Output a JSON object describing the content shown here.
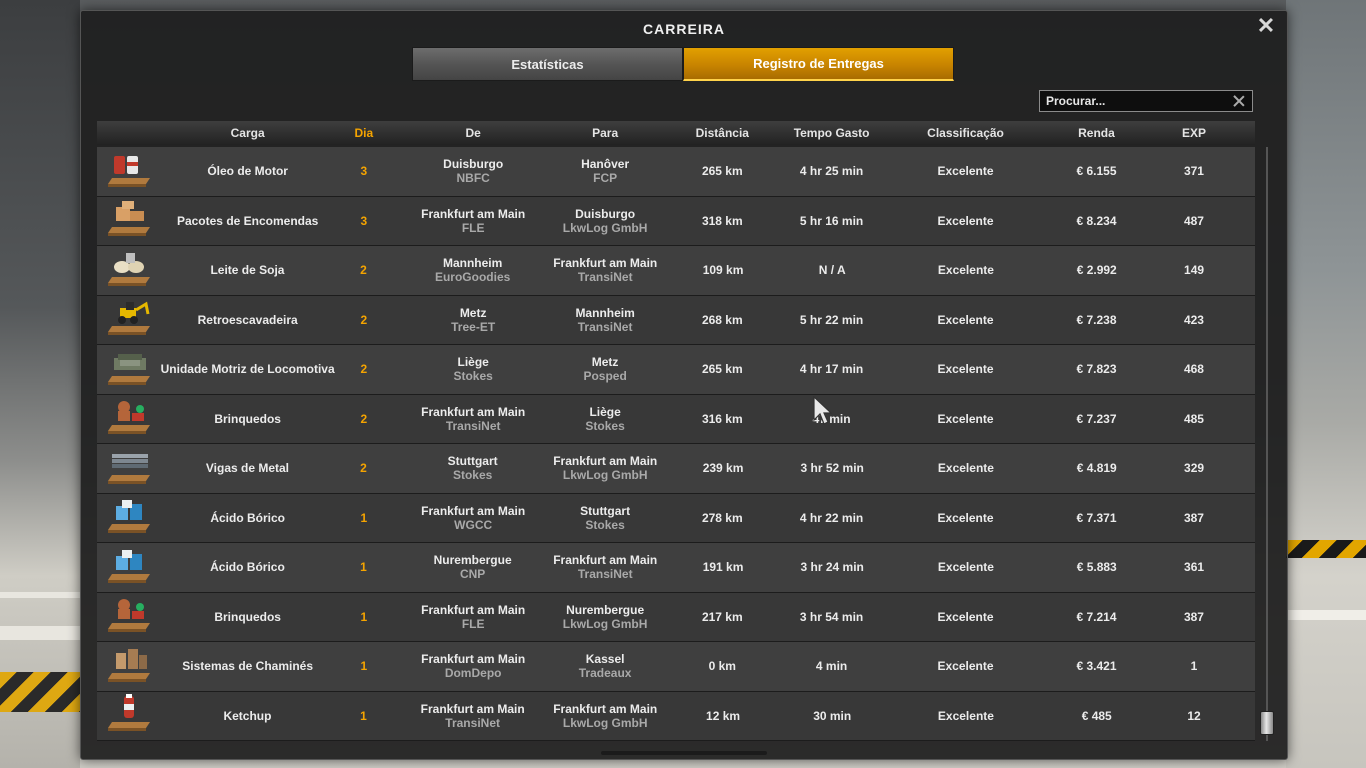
{
  "window": {
    "title": "CARREIRA"
  },
  "tabs": [
    {
      "label": "Estatísticas",
      "active": false
    },
    {
      "label": "Registro de Entregas",
      "active": true
    }
  ],
  "search": {
    "placeholder": "Procurar..."
  },
  "columns": {
    "carga": "Carga",
    "dia": "Dia",
    "de": "De",
    "para": "Para",
    "distancia": "Distância",
    "tempo": "Tempo Gasto",
    "classificacao": "Classificação",
    "renda": "Renda",
    "exp": "EXP"
  },
  "colors": {
    "accent": "#f5a400",
    "tab_active": "#d08c00"
  },
  "deliveries": [
    {
      "icon": "barrels-cargo-icon",
      "carga": "Óleo de Motor",
      "dia": "3",
      "de_city": "Duisburgo",
      "de_company": "NBFC",
      "para_city": "Hanôver",
      "para_company": "FCP",
      "distancia": "265 km",
      "tempo": "4 hr 25 min",
      "classificacao": "Excelente",
      "renda": "€ 6.155",
      "exp": "371"
    },
    {
      "icon": "boxes-cargo-icon",
      "carga": "Pacotes de Encomendas",
      "dia": "3",
      "de_city": "Frankfurt am Main",
      "de_company": "FLE",
      "para_city": "Duisburgo",
      "para_company": "LkwLog GmbH",
      "distancia": "318 km",
      "tempo": "5 hr 16 min",
      "classificacao": "Excelente",
      "renda": "€ 8.234",
      "exp": "487"
    },
    {
      "icon": "sacks-cargo-icon",
      "carga": "Leite de Soja",
      "dia": "2",
      "de_city": "Mannheim",
      "de_company": "EuroGoodies",
      "para_city": "Frankfurt am Main",
      "para_company": "TransiNet",
      "distancia": "109 km",
      "tempo": "N / A",
      "classificacao": "Excelente",
      "renda": "€ 2.992",
      "exp": "149"
    },
    {
      "icon": "backhoe-cargo-icon",
      "carga": "Retroescavadeira",
      "dia": "2",
      "de_city": "Metz",
      "de_company": "Tree-ET",
      "para_city": "Mannheim",
      "para_company": "TransiNet",
      "distancia": "268 km",
      "tempo": "5 hr 22 min",
      "classificacao": "Excelente",
      "renda": "€ 7.238",
      "exp": "423"
    },
    {
      "icon": "engine-cargo-icon",
      "carga": "Unidade Motriz de Locomotiva",
      "dia": "2",
      "de_city": "Liège",
      "de_company": "Stokes",
      "para_city": "Metz",
      "para_company": "Posped",
      "distancia": "265 km",
      "tempo": "4 hr 17 min",
      "classificacao": "Excelente",
      "renda": "€ 7.823",
      "exp": "468"
    },
    {
      "icon": "toys-cargo-icon",
      "carga": "Brinquedos",
      "dia": "2",
      "de_city": "Frankfurt am Main",
      "de_company": "TransiNet",
      "para_city": "Liège",
      "para_company": "Stokes",
      "distancia": "316 km",
      "tempo": "47 min",
      "classificacao": "Excelente",
      "renda": "€ 7.237",
      "exp": "485"
    },
    {
      "icon": "beams-cargo-icon",
      "carga": "Vigas de Metal",
      "dia": "2",
      "de_city": "Stuttgart",
      "de_company": "Stokes",
      "para_city": "Frankfurt am Main",
      "para_company": "LkwLog GmbH",
      "distancia": "239 km",
      "tempo": "3 hr 52 min",
      "classificacao": "Excelente",
      "renda": "€ 4.819",
      "exp": "329"
    },
    {
      "icon": "chemical-cargo-icon",
      "carga": "Ácido Bórico",
      "dia": "1",
      "de_city": "Frankfurt am Main",
      "de_company": "WGCC",
      "para_city": "Stuttgart",
      "para_company": "Stokes",
      "distancia": "278 km",
      "tempo": "4 hr 22 min",
      "classificacao": "Excelente",
      "renda": "€ 7.371",
      "exp": "387"
    },
    {
      "icon": "chemical-cargo-icon",
      "carga": "Ácido Bórico",
      "dia": "1",
      "de_city": "Nurembergue",
      "de_company": "CNP",
      "para_city": "Frankfurt am Main",
      "para_company": "TransiNet",
      "distancia": "191 km",
      "tempo": "3 hr 24 min",
      "classificacao": "Excelente",
      "renda": "€ 5.883",
      "exp": "361"
    },
    {
      "icon": "toys-cargo-icon",
      "carga": "Brinquedos",
      "dia": "1",
      "de_city": "Frankfurt am Main",
      "de_company": "FLE",
      "para_city": "Nurembergue",
      "para_company": "LkwLog GmbH",
      "distancia": "217 km",
      "tempo": "3 hr 54 min",
      "classificacao": "Excelente",
      "renda": "€ 7.214",
      "exp": "387"
    },
    {
      "icon": "chimney-cargo-icon",
      "carga": "Sistemas de Chaminés",
      "dia": "1",
      "de_city": "Frankfurt am Main",
      "de_company": "DomDepo",
      "para_city": "Kassel",
      "para_company": "Tradeaux",
      "distancia": "0 km",
      "tempo": "4 min",
      "classificacao": "Excelente",
      "renda": "€ 3.421",
      "exp": "1"
    },
    {
      "icon": "ketchup-cargo-icon",
      "carga": "Ketchup",
      "dia": "1",
      "de_city": "Frankfurt am Main",
      "de_company": "TransiNet",
      "para_city": "Frankfurt am Main",
      "para_company": "LkwLog GmbH",
      "distancia": "12 km",
      "tempo": "30 min",
      "classificacao": "Excelente",
      "renda": "€ 485",
      "exp": "12"
    }
  ]
}
